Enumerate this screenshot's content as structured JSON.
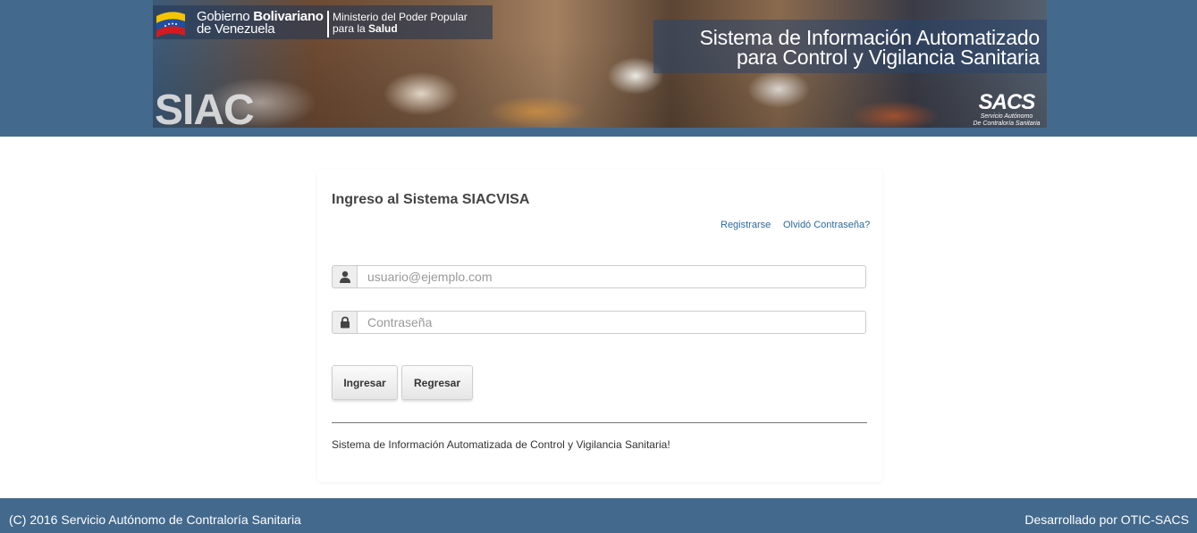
{
  "header": {
    "gov_line1_prefix": "Gobierno ",
    "gov_line1_bold": "Bolivariano",
    "gov_line2": "de Venezuela",
    "ministry_line1": "Ministerio del Poder Popular",
    "ministry_line2_prefix": "para la ",
    "ministry_line2_bold": "Salud",
    "system_title_line1": "Sistema de Información  Automatizado",
    "system_title_line2": "para Control y Vigilancia Sanitaria",
    "siac_logo": "SIAC",
    "sacs_logo": "SACS",
    "sacs_logo_line1": "Servicio Autónomo",
    "sacs_logo_line2": "De Contraloría Sanitaria"
  },
  "login": {
    "title": "Ingreso al Sistema SIACVISA",
    "register_link": "Registrarse",
    "forgot_link": "Olvidó Contraseña?",
    "email_placeholder": "usuario@ejemplo.com",
    "email_value": "",
    "password_placeholder": "Contraseña",
    "password_value": "",
    "submit_label": "Ingresar",
    "back_label": "Regresar",
    "tagline": "Sistema de Información Automatizada de Control y Vigilancia Sanitaria!"
  },
  "footer": {
    "copyright": "(C) 2016 Servicio Autónomo de Contraloría Sanitaria",
    "developer": "Desarrollado por OTIC-SACS"
  },
  "icons": {
    "user": "user-icon",
    "lock": "lock-icon",
    "flag": "venezuela-flag-icon"
  },
  "colors": {
    "band": "#43698d",
    "link": "#2a6a9e",
    "title_text": "#444444"
  }
}
